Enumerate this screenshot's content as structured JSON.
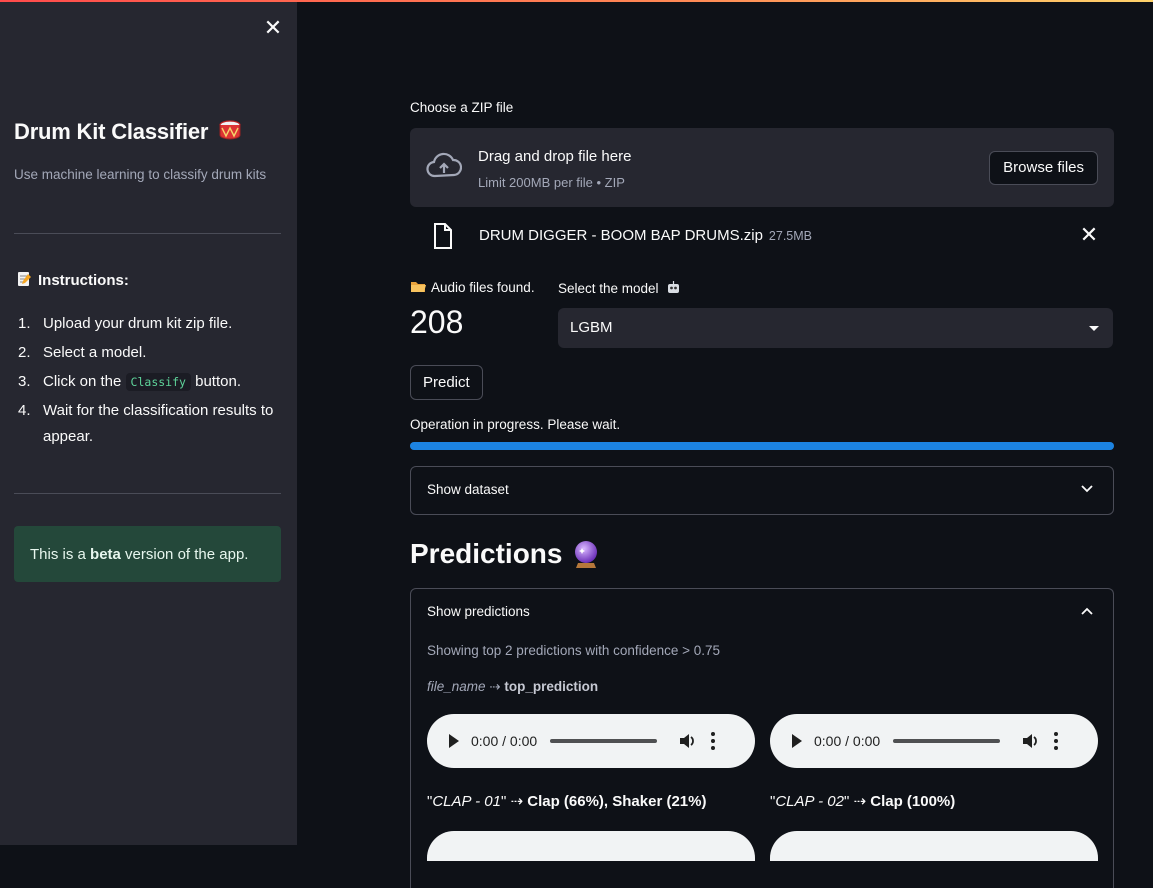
{
  "sidebar": {
    "close_glyph": "✕",
    "title": "Drum Kit Classifier",
    "subtitle": "Use machine learning to classify drum kits",
    "instructions_heading": "Instructions:",
    "steps": [
      {
        "num": "1.",
        "text": "Upload your drum kit zip file."
      },
      {
        "num": "2.",
        "text": "Select a model."
      },
      {
        "num": "3.",
        "before": "Click on the",
        "code": "Classify",
        "after": "button."
      },
      {
        "num": "4.",
        "text": "Wait for the classification results to appear."
      }
    ],
    "beta_before": "This is a",
    "beta_bold": "beta",
    "beta_after": "version of the app."
  },
  "uploader": {
    "label": "Choose a ZIP file",
    "drag_text": "Drag and drop file here",
    "limit_text": "Limit 200MB per file • ZIP",
    "browse_label": "Browse files",
    "file_name": "DRUM DIGGER - BOOM BAP DRUMS.zip",
    "file_size": "27.5MB"
  },
  "metric": {
    "label": "Audio files found.",
    "value": "208"
  },
  "model_select": {
    "label": "Select the model",
    "value": "LGBM"
  },
  "predict_label": "Predict",
  "progress": {
    "text": "Operation in progress. Please wait.",
    "fraction": 1.0
  },
  "dataset_expander": {
    "label": "Show dataset"
  },
  "predictions": {
    "heading": "Predictions",
    "expander_label": "Show predictions",
    "caption": "Showing top 2 predictions with confidence > 0.75",
    "format_italic": "file_name",
    "format_arrow": "⇢",
    "format_bold": "top_prediction",
    "items": [
      {
        "time": "0:00 / 0:00",
        "file": "CLAP - 01",
        "result": "Clap (66%), Shaker (21%)"
      },
      {
        "time": "0:00 / 0:00",
        "file": "CLAP - 02",
        "result": "Clap (100%)"
      }
    ],
    "quote": "\"",
    "arrow": "⇢"
  },
  "colors": {
    "accent_blue": "#1c83e1",
    "sidebar_bg": "#262730",
    "main_bg": "#0e1117",
    "success_bg": "#24483a"
  },
  "icons": [
    "close-icon",
    "drum-icon",
    "memo-icon",
    "cloud-upload-icon",
    "file-icon",
    "folder-icon",
    "robot-icon",
    "crystal-ball-icon",
    "chevron-down-icon",
    "chevron-up-icon",
    "play-icon",
    "volume-icon",
    "more-icon"
  ]
}
